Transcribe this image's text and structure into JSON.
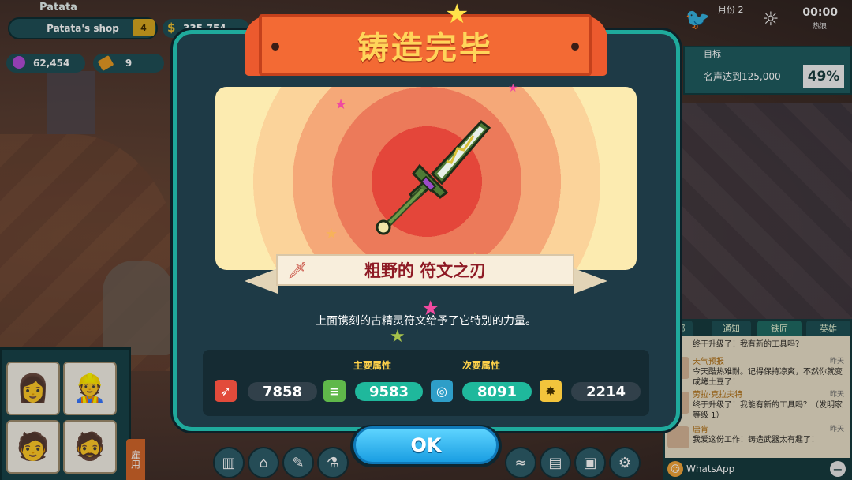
{
  "hud": {
    "player_name": "Patata",
    "shop_name": "Patata's shop",
    "level": "4",
    "gold": "335,754",
    "gems": "62,454",
    "tickets": "9",
    "month": "月份 2",
    "month_sub": "2",
    "time": "00:00",
    "weather": "热浪"
  },
  "goal": {
    "title": "目标",
    "text": "名声达到125,000",
    "percent": "49%"
  },
  "modal": {
    "title": "铸造完毕",
    "item_name": "粗野的 符文之刃",
    "description": "上面镌刻的古精灵符文给予了它特别的力量。",
    "primary_label": "主要属性",
    "secondary_label": "次要属性",
    "ok_label": "OK"
  },
  "stats": [
    {
      "icon": "attack-icon",
      "value": "7858",
      "color": "#e24b3b"
    },
    {
      "icon": "craft-icon",
      "value": "9583",
      "color": "#5fb84a"
    },
    {
      "icon": "target-icon",
      "value": "8091",
      "color": "#2e9ec8"
    },
    {
      "icon": "star-burst-icon",
      "value": "2214",
      "color": "#f2c43c"
    }
  ],
  "chat": {
    "tabs": [
      "部",
      "通知",
      "铁匠",
      "英雄"
    ],
    "messages": [
      {
        "who": "",
        "time": "",
        "text": "终于升级了！我有新的工具吗？"
      },
      {
        "who": "天气预报",
        "time": "昨天",
        "text": "今天酷热难耐。记得保持凉爽，不然你就变成烤土豆了！"
      },
      {
        "who": "劳拉·克拉夫特",
        "time": "昨天",
        "text": "终于升级了！我能有新的工具吗？（发明家 等级 1）"
      },
      {
        "who": "唐肯",
        "time": "昨天",
        "text": "我爱这份工作！铸造武器太有趣了！"
      }
    ],
    "whatsapp_label": "WhatsApp"
  },
  "hire_tab_label": "雇用"
}
